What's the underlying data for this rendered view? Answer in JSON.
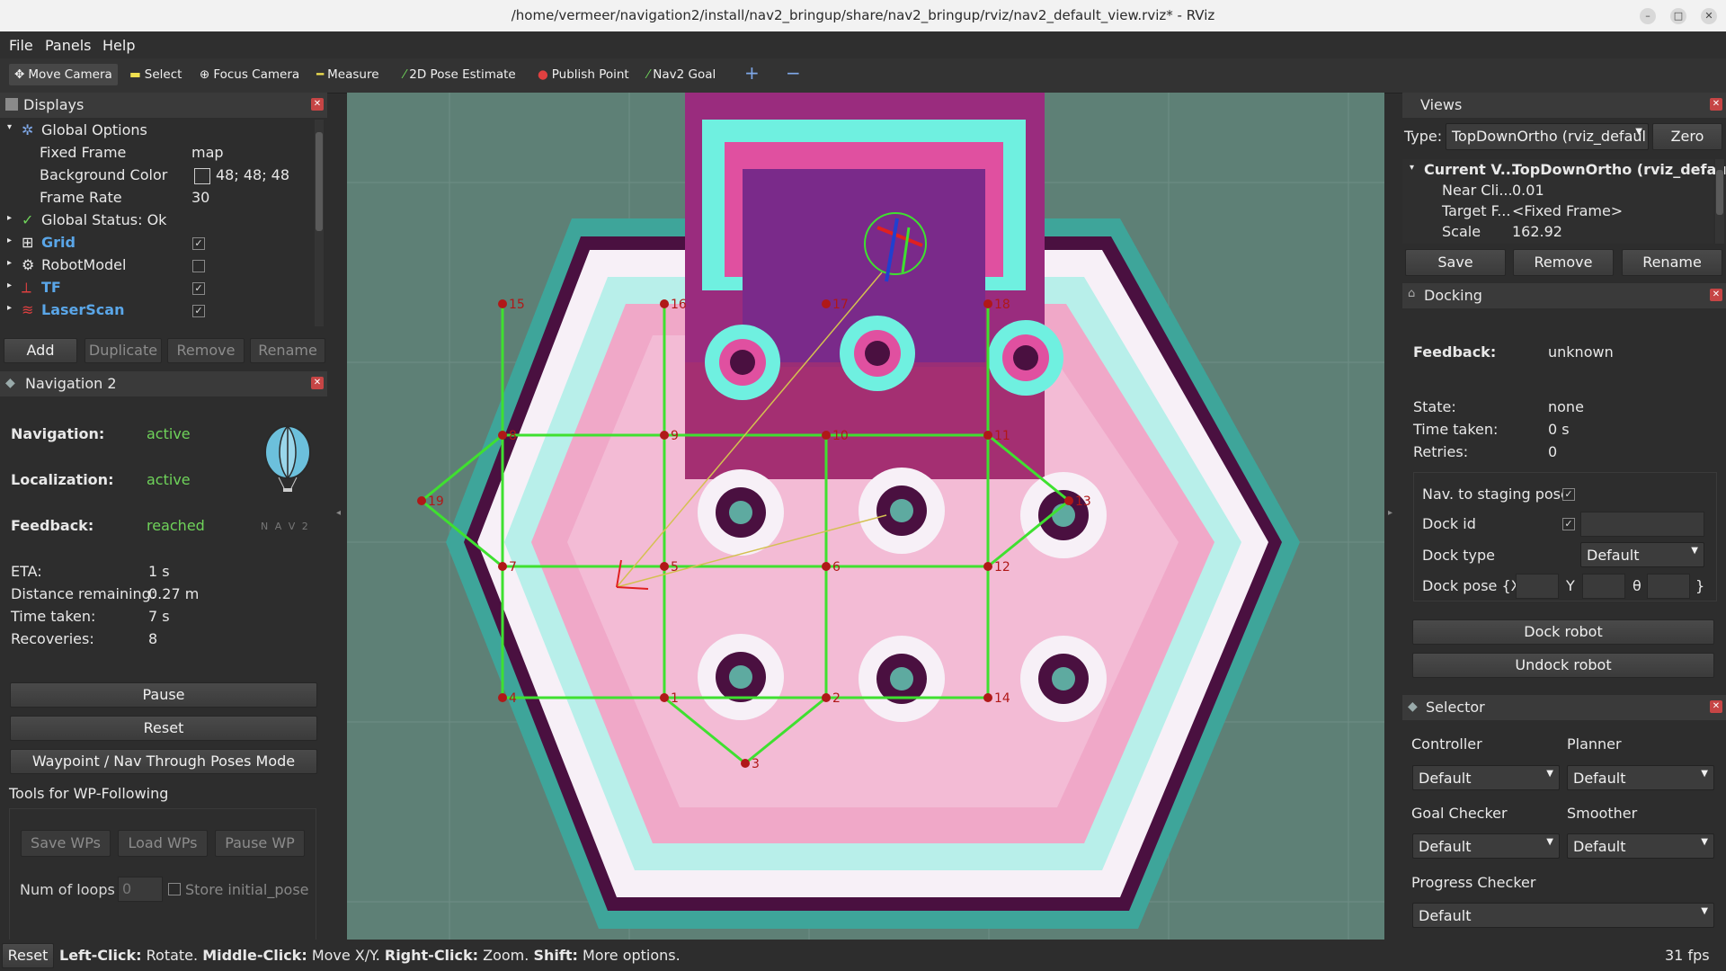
{
  "window": {
    "title": "/home/vermeer/navigation2/install/nav2_bringup/share/nav2_bringup/rviz/nav2_default_view.rviz* - RViz"
  },
  "menu": [
    "File",
    "Panels",
    "Help"
  ],
  "toolbar": {
    "tools": [
      {
        "label": "Move Camera",
        "icon": "move-camera-icon"
      },
      {
        "label": "Select",
        "icon": "select-icon"
      },
      {
        "label": "Focus Camera",
        "icon": "focus-camera-icon"
      },
      {
        "label": "Measure",
        "icon": "measure-icon"
      },
      {
        "label": "2D Pose Estimate",
        "icon": "pose-estimate-icon"
      },
      {
        "label": "Publish Point",
        "icon": "publish-point-icon"
      },
      {
        "label": "Nav2 Goal",
        "icon": "nav2-goal-icon"
      }
    ],
    "plus": "+",
    "minus": "−"
  },
  "displays": {
    "title": "Displays",
    "tree": {
      "global_options": "Global Options",
      "fixed_frame_label": "Fixed Frame",
      "fixed_frame_value": "map",
      "bg_color_label": "Background Color",
      "bg_color_value": "48; 48; 48",
      "frame_rate_label": "Frame Rate",
      "frame_rate_value": "30",
      "global_status": "Global Status: Ok",
      "grid": "Grid",
      "robot_model": "RobotModel",
      "tf": "TF",
      "laser_scan": "LaserScan"
    },
    "buttons": {
      "add": "Add",
      "duplicate": "Duplicate",
      "remove": "Remove",
      "rename": "Rename"
    }
  },
  "nav2": {
    "title": "Navigation 2",
    "navigation_label": "Navigation:",
    "navigation_value": "active",
    "localization_label": "Localization:",
    "localization_value": "active",
    "feedback_label": "Feedback:",
    "feedback_value": "reached",
    "logo_text": "N A V 2",
    "eta_label": "ETA:",
    "eta_value": "1 s",
    "distance_label": "Distance remaining:",
    "distance_value": "0.27 m",
    "time_label": "Time taken:",
    "time_value": "7 s",
    "recoveries_label": "Recoveries:",
    "recoveries_value": "8",
    "pause": "Pause",
    "reset": "Reset",
    "waypoint_mode": "Waypoint / Nav Through Poses Mode",
    "tools_label": "Tools for WP-Following",
    "save_wps": "Save WPs",
    "load_wps": "Load WPs",
    "pause_wp": "Pause WP",
    "loops_label": "Num of loops",
    "loops_value": "0",
    "store_pose": "Store initial_pose"
  },
  "views": {
    "title": "Views",
    "type_label": "Type:",
    "type_value": "TopDownOrtho (rviz_defaul",
    "zero": "Zero",
    "current_label": "Current V...",
    "current_value": "TopDownOrtho (rviz_defaul...",
    "near_label": "Near Cli...",
    "near_value": "0.01",
    "target_label": "Target F...",
    "target_value": "<Fixed Frame>",
    "scale_label": "Scale",
    "scale_value": "162.92",
    "save": "Save",
    "remove": "Remove",
    "rename": "Rename"
  },
  "docking": {
    "title": "Docking",
    "feedback_label": "Feedback:",
    "feedback_value": "unknown",
    "state_label": "State:",
    "state_value": "none",
    "time_label": "Time taken:",
    "time_value": "0 s",
    "retries_label": "Retries:",
    "retries_value": "0",
    "staging_label": "Nav. to staging pose",
    "dock_id_label": "Dock id",
    "dock_type_label": "Dock type",
    "dock_type_value": "Default",
    "dock_pose_label": "Dock pose {X",
    "y_label": "Y",
    "theta_label": "θ",
    "close_brace": "}",
    "dock_robot": "Dock robot",
    "undock_robot": "Undock robot"
  },
  "selector": {
    "title": "Selector",
    "controller_label": "Controller",
    "controller_value": "Default",
    "planner_label": "Planner",
    "planner_value": "Default",
    "goal_checker_label": "Goal Checker",
    "goal_checker_value": "Default",
    "smoother_label": "Smoother",
    "smoother_value": "Default",
    "progress_checker_label": "Progress Checker",
    "progress_checker_value": "Default"
  },
  "status": {
    "reset": "Reset",
    "left": "Left-Click:",
    "left_t": "Rotate.",
    "middle": "Middle-Click:",
    "middle_t": "Move X/Y.",
    "right": "Right-Click:",
    "right_t": "Zoom.",
    "shift": "Shift:",
    "shift_t": "More options.",
    "fps": "31 fps"
  },
  "map": {
    "nodes": [
      {
        "id": "1",
        "x": 0,
        "y": 0
      },
      {
        "id": "2",
        "x": 2,
        "y": 0
      },
      {
        "id": "3",
        "x": 1,
        "y": -1
      },
      {
        "id": "4",
        "x": -2,
        "y": 0
      },
      {
        "id": "5",
        "x": 0,
        "y": 2
      },
      {
        "id": "6",
        "x": 2,
        "y": 2
      },
      {
        "id": "7",
        "x": -2,
        "y": 2
      },
      {
        "id": "8",
        "x": -2,
        "y": 4
      },
      {
        "id": "9",
        "x": 0,
        "y": 4
      },
      {
        "id": "10",
        "x": 2,
        "y": 4
      },
      {
        "id": "11",
        "x": 4,
        "y": 4
      },
      {
        "id": "12",
        "x": 4,
        "y": 2
      },
      {
        "id": "13",
        "x": 5,
        "y": 3
      },
      {
        "id": "14",
        "x": 4,
        "y": 0
      },
      {
        "id": "15",
        "x": -2,
        "y": 6
      },
      {
        "id": "16",
        "x": 0,
        "y": 6
      },
      {
        "id": "17",
        "x": 2,
        "y": 6
      },
      {
        "id": "18",
        "x": 4,
        "y": 6
      },
      {
        "id": "19",
        "x": -3,
        "y": 3
      }
    ],
    "edges": [
      [
        "1",
        "2"
      ],
      [
        "1",
        "4"
      ],
      [
        "2",
        "14"
      ],
      [
        "1",
        "3"
      ],
      [
        "2",
        "3"
      ],
      [
        "1",
        "5"
      ],
      [
        "2",
        "6"
      ],
      [
        "4",
        "7"
      ],
      [
        "14",
        "12"
      ],
      [
        "5",
        "6"
      ],
      [
        "5",
        "7"
      ],
      [
        "6",
        "12"
      ],
      [
        "7",
        "8"
      ],
      [
        "12",
        "11"
      ],
      [
        "8",
        "9"
      ],
      [
        "9",
        "10"
      ],
      [
        "10",
        "11"
      ],
      [
        "5",
        "9"
      ],
      [
        "6",
        "10"
      ],
      [
        "8",
        "15"
      ],
      [
        "9",
        "16"
      ],
      [
        "11",
        "18"
      ],
      [
        "7",
        "19"
      ],
      [
        "8",
        "19"
      ],
      [
        "11",
        "13"
      ],
      [
        "12",
        "13"
      ]
    ],
    "colors": {
      "edge": "#3fe030",
      "node": "#b01818",
      "free": "#f0a8c8",
      "inflation": "#f7f0f7",
      "lethal": "#4a1040",
      "wall": "#6ff0e0"
    }
  }
}
